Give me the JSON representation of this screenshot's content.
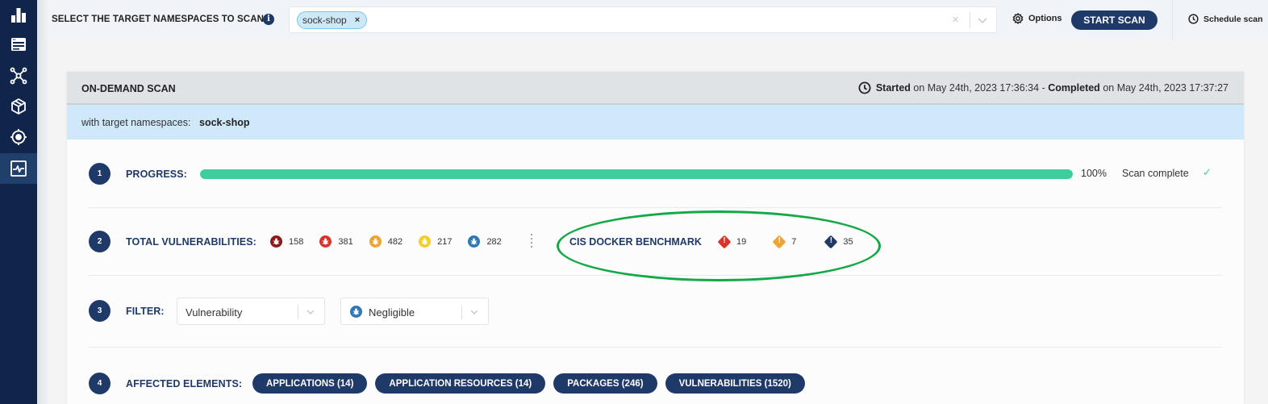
{
  "sidebar": {
    "items": [
      {
        "name": "dashboard",
        "icon": "bar-chart-icon",
        "active": false
      },
      {
        "name": "applications",
        "icon": "window-list-icon",
        "active": false
      },
      {
        "name": "application-resources",
        "icon": "network-nodes-icon",
        "active": false
      },
      {
        "name": "packages",
        "icon": "package-box-icon",
        "active": false
      },
      {
        "name": "vulnerabilities",
        "icon": "bug-target-icon",
        "active": false
      },
      {
        "name": "runtime-scan",
        "icon": "pulse-monitor-icon",
        "active": true
      }
    ]
  },
  "topbar": {
    "namespace_label": "SELECT THE TARGET NAMESPACES TO SCAN:",
    "info_icon": "i",
    "selected_namespaces": [
      "sock-shop"
    ],
    "chip_remove": "×",
    "clear_icon": "×",
    "options_label": "Options",
    "start_scan_label": "START SCAN",
    "schedule_label": "Schedule scan"
  },
  "scan": {
    "title": "ON-DEMAND SCAN",
    "started_label": "Started",
    "started_text": "on May 24th, 2023 17:36:34",
    "separator": "-",
    "completed_label": "Completed",
    "completed_text": "on May 24th, 2023 17:37:27",
    "target_label": "with target namespaces:",
    "target_value": "sock-shop"
  },
  "steps": {
    "progress": {
      "number": "1",
      "label": "PROGRESS:",
      "percent": 100,
      "percent_text": "100%",
      "status": "Scan complete",
      "check": "✓"
    },
    "vulnerabilities": {
      "number": "2",
      "label": "TOTAL VULNERABILITIES:",
      "counts": [
        {
          "severity": "critical",
          "count": "158",
          "color": "#8b1a1a"
        },
        {
          "severity": "high",
          "count": "381",
          "color": "#d9342b"
        },
        {
          "severity": "medium",
          "count": "482",
          "color": "#f0a232"
        },
        {
          "severity": "low",
          "count": "217",
          "color": "#f2cd2e"
        },
        {
          "severity": "negligible",
          "count": "282",
          "color": "#2e78b7"
        }
      ],
      "cis_label": "CIS DOCKER BENCHMARK",
      "cis_counts": [
        {
          "level": "fatal",
          "count": "19",
          "color": "#d9342b"
        },
        {
          "level": "warn",
          "count": "7",
          "color": "#f0a232"
        },
        {
          "level": "info",
          "count": "35",
          "color": "#1f3a68"
        }
      ],
      "highlight_color": "#14a847"
    },
    "filter": {
      "number": "3",
      "label": "FILTER:",
      "type_value": "Vulnerability",
      "severity_value": "Negligible"
    },
    "affected": {
      "number": "4",
      "label": "AFFECTED ELEMENTS:",
      "buttons": [
        "APPLICATIONS (14)",
        "APPLICATION RESOURCES (14)",
        "PACKAGES (246)",
        "VULNERABILITIES (1520)"
      ]
    }
  },
  "colors": {
    "brand": "#1f3a68",
    "sidebar": "#11254a",
    "progress": "#3ecd9c",
    "sub_header": "#cfe9fa"
  }
}
